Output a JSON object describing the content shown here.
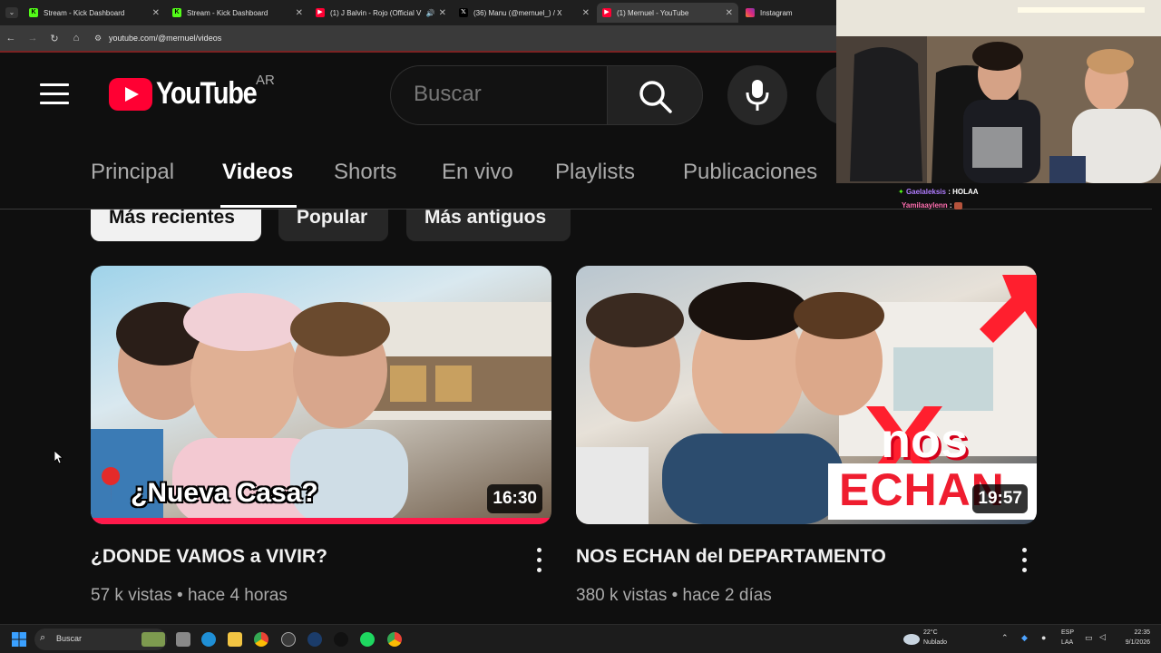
{
  "browser": {
    "tabs": [
      {
        "title": "Stream - Kick Dashboard",
        "icon": "kick-icon",
        "color": "#53fc18"
      },
      {
        "title": "Stream - Kick Dashboard",
        "icon": "kick-icon",
        "color": "#53fc18"
      },
      {
        "title": "(1) J Balvin - Rojo (Official V",
        "icon": "youtube-icon",
        "color": "#ff0033"
      },
      {
        "title": "(36) Manu (@mernuel_) / X",
        "icon": "x-icon",
        "color": "#ffffff"
      },
      {
        "title": "(1) Mernuel - YouTube",
        "icon": "youtube-icon",
        "color": "#ff0033"
      },
      {
        "title": "Instagram",
        "icon": "instagram-icon",
        "color": "#e1306c"
      }
    ],
    "url": "youtube.com/@mernuel/videos"
  },
  "masthead": {
    "wordmark": "YouTube",
    "country": "AR",
    "search_placeholder": "Buscar"
  },
  "channel_tabs": [
    "Principal",
    "Videos",
    "Shorts",
    "En vivo",
    "Playlists",
    "Publicaciones"
  ],
  "chips": [
    "Más recientes",
    "Popular",
    "Más antiguos"
  ],
  "videos": [
    {
      "title": "¿DONDE VAMOS a VIVIR?",
      "views": "57 k vistas",
      "age": "hace 4 horas",
      "duration": "16:30",
      "thumb_text": "¿Nueva Casa?"
    },
    {
      "title": "NOS ECHAN del DEPARTAMENTO",
      "views": "380 k vistas",
      "age": "hace 2 días",
      "duration": "19:57",
      "thumb_text_1": "nos",
      "thumb_text_2": "ECHAN"
    }
  ],
  "chat": [
    {
      "user": "Gaelaleksis",
      "message": "HOLAA"
    },
    {
      "user": "Yamilaaylenn",
      "message": ""
    }
  ],
  "taskbar": {
    "search_label": "Buscar",
    "weather_temp": "22°C",
    "weather_desc": "Nublado",
    "lang_1": "ESP",
    "lang_2": "LAA",
    "time": "22:35",
    "date": "9/1/2026"
  }
}
